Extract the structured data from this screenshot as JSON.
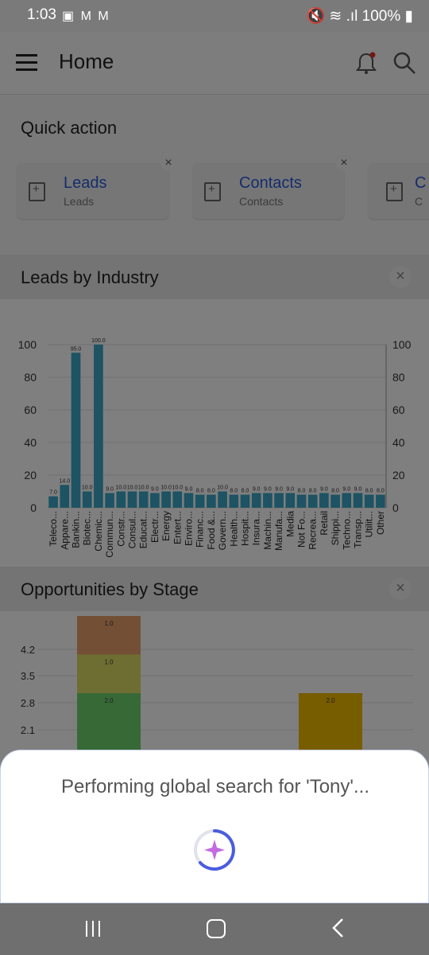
{
  "status_bar": {
    "time": "1:03",
    "battery": "100%"
  },
  "header": {
    "title": "Home"
  },
  "quick_action": {
    "title": "Quick action",
    "cards": [
      {
        "label": "Leads",
        "sub": "Leads"
      },
      {
        "label": "Contacts",
        "sub": "Contacts"
      },
      {
        "label": "C",
        "sub": "C"
      }
    ]
  },
  "sections": {
    "leads_by_industry": "Leads by Industry",
    "opportunities_by_stage": "Opportunities by Stage"
  },
  "colors": {
    "bar": "#3aa6c6",
    "accent": "#2a5bd7",
    "stage_1": "#e6a06a",
    "stage_2": "#dddd66",
    "stage_3": "#6fd36f",
    "stage_4": "#f0b800"
  },
  "chart_data": [
    {
      "type": "bar",
      "title": "Leads by Industry",
      "categories": [
        "Teleco...",
        "Appare...",
        "Bankin...",
        "Biotec...",
        "Chemic...",
        "Commun...",
        "Constr...",
        "Consul...",
        "Educat...",
        "Electr...",
        "Energy",
        "Entert...",
        "Enviro...",
        "Financ...",
        "Food &...",
        "Govern...",
        "Health...",
        "Hospit...",
        "Insura...",
        "Machin...",
        "Manufa...",
        "Media",
        "Not Fo...",
        "Recrea...",
        "Retail",
        "Shippi...",
        "Techno...",
        "Transp...",
        "Utilit...",
        "Other"
      ],
      "values": [
        7.0,
        14.0,
        95.0,
        10.0,
        100.0,
        9.0,
        10.0,
        10.0,
        10.0,
        9.0,
        10.0,
        10.0,
        9.0,
        8.0,
        8.0,
        10.0,
        8.0,
        8.0,
        9.0,
        9.0,
        9.0,
        9.0,
        8.0,
        8.0,
        9.0,
        8.0,
        9.0,
        9.0,
        8.0,
        8.0
      ],
      "ylim": [
        0,
        100
      ],
      "yticks": [
        0,
        20,
        40,
        60,
        80,
        100
      ]
    },
    {
      "type": "bar",
      "title": "Opportunities by Stage",
      "yticks": [
        "4.2",
        "3.5",
        "2.8",
        "2.1"
      ],
      "segments": [
        {
          "label": "2.0",
          "value": 2.0
        },
        {
          "label": "1.0",
          "value": 1.0
        },
        {
          "label": "1.0",
          "value": 1.0
        }
      ],
      "second_bar": {
        "label": "2.0",
        "value": 2.0
      }
    }
  ],
  "sheet": {
    "message": "Performing global search for 'Tony'..."
  }
}
